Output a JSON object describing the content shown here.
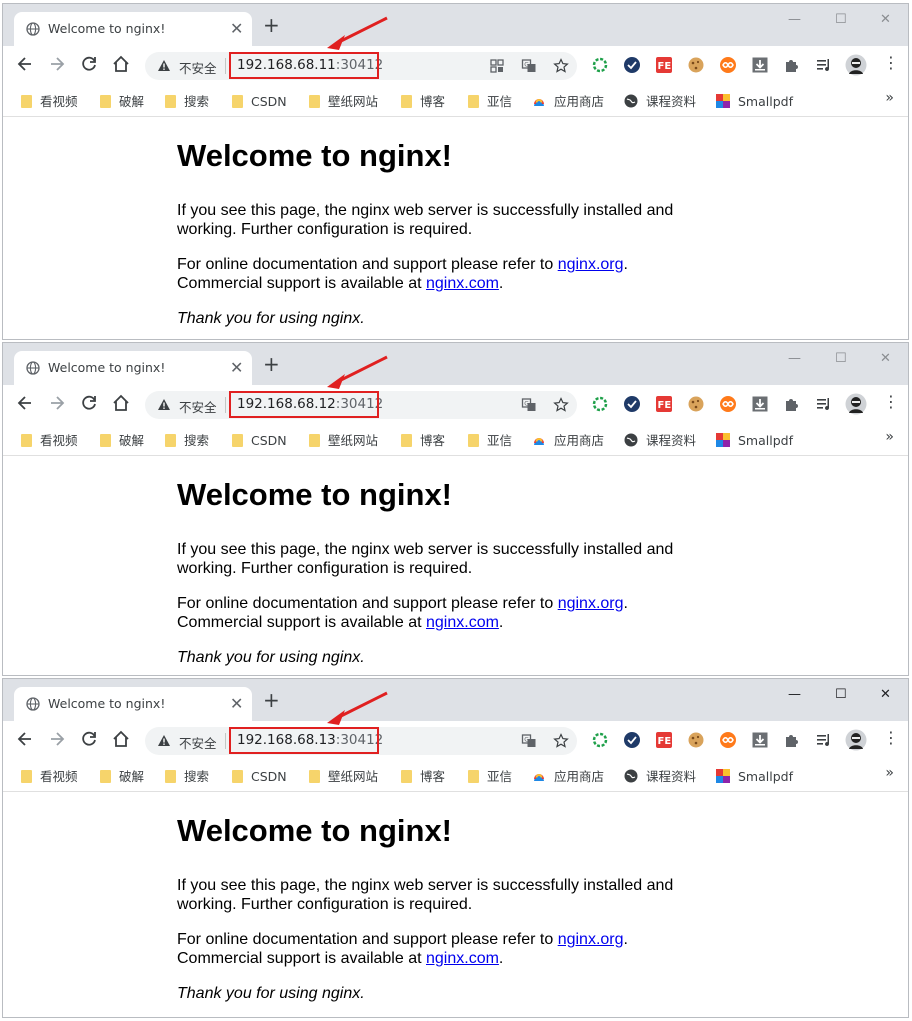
{
  "colors": {
    "accent_red": "#e02020",
    "link": "#0000ee",
    "titlebar": "#dee1e6"
  },
  "bookmarks": [
    {
      "label": "看视频",
      "icon": "folder-icon"
    },
    {
      "label": "破解",
      "icon": "folder-icon"
    },
    {
      "label": "搜索",
      "icon": "folder-icon"
    },
    {
      "label": "CSDN",
      "icon": "folder-icon"
    },
    {
      "label": "壁纸网站",
      "icon": "folder-icon"
    },
    {
      "label": "博客",
      "icon": "folder-icon"
    },
    {
      "label": "亚信",
      "icon": "folder-icon"
    },
    {
      "label": "应用商店",
      "icon": "app-store-icon"
    },
    {
      "label": "课程资料",
      "icon": "globe-icon"
    },
    {
      "label": "Smallpdf",
      "icon": "smallpdf-icon"
    }
  ],
  "windows": [
    {
      "tab_title": "Welcome to nginx!",
      "insecure_label": "不安全",
      "url_host": "192.168.68.11",
      "url_port": ":30412",
      "page": {
        "heading": "Welcome to nginx!",
        "p1_line1": "If you see this page, the nginx web server is successfully installed and",
        "p1_line2": "working. Further configuration is required.",
        "p2_line1": "For online documentation and support please refer to",
        "p2_link1": "nginx.org",
        "p2_line2": "Commercial support is available at",
        "p2_link2": "nginx.com",
        "p3": "Thank you for using nginx."
      }
    },
    {
      "tab_title": "Welcome to nginx!",
      "insecure_label": "不安全",
      "url_host": "192.168.68.12",
      "url_port": ":30412",
      "page": {
        "heading": "Welcome to nginx!",
        "p1_line1": "If you see this page, the nginx web server is successfully installed and",
        "p1_line2": "working. Further configuration is required.",
        "p2_line1": "For online documentation and support please refer to",
        "p2_link1": "nginx.org",
        "p2_line2": "Commercial support is available at",
        "p2_link2": "nginx.com",
        "p3": "Thank you for using nginx."
      }
    },
    {
      "tab_title": "Welcome to nginx!",
      "insecure_label": "不安全",
      "url_host": "192.168.68.13",
      "url_port": ":30412",
      "page": {
        "heading": "Welcome to nginx!",
        "p1_line1": "If you see this page, the nginx web server is successfully installed and",
        "p1_line2": "working. Further configuration is required.",
        "p2_line1": "For online documentation and support please refer to",
        "p2_link1": "nginx.org",
        "p2_line2": "Commercial support is available at",
        "p2_link2": "nginx.com",
        "p3": "Thank you for using nginx."
      }
    }
  ]
}
